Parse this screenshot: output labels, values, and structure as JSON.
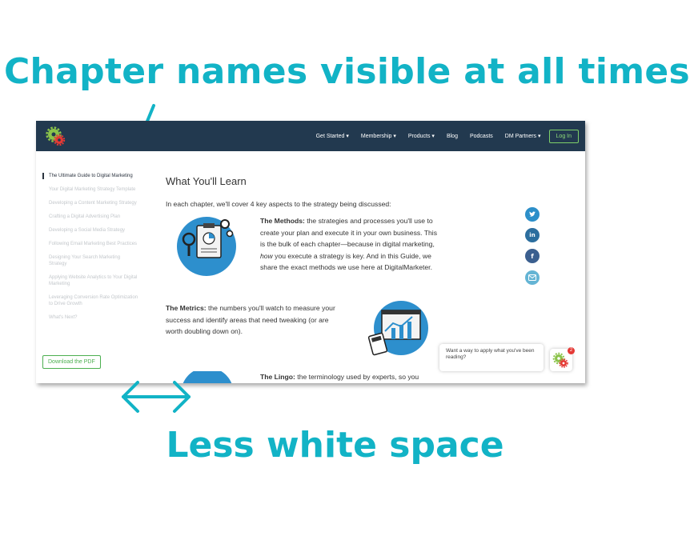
{
  "headline_top": "Chapter names visible at all times",
  "headline_bottom": "Less white space",
  "nav": {
    "items": [
      "Get Started",
      "Membership",
      "Products",
      "Blog",
      "Podcasts",
      "DM Partners"
    ],
    "login": "Log In"
  },
  "sidebar": {
    "items": [
      "The Ultimate Guide to Digital Marketing",
      "Your Digital Marketing Strategy Template",
      "Developing a Content Marketing Strategy",
      "Crafting a Digital Advertising Plan",
      "Developing a Social Media Strategy",
      "Following Email Marketing Best Practices",
      "Designing Your Search Marketing Strategy",
      "Applying Website Analytics to Your Digital Marketing",
      "Leveraging Conversion Rate Optimization to Drive Growth",
      "What's Next?"
    ],
    "pdf_button": "Download the PDF"
  },
  "main": {
    "title": "What You'll Learn",
    "intro": "In each chapter, we'll cover 4 key aspects to the strategy being discussed:",
    "methods_label": "The Methods:",
    "methods_text_1": " the strategies and processes you'll use to create your plan and execute it in your own business. This is the bulk of each chapter—because in digital marketing, ",
    "methods_em": "how",
    "methods_text_2": " you execute a strategy is key. And in this Guide, we share the exact methods we use here at DigitalMarketer.",
    "metrics_label": "The Metrics:",
    "metrics_text": " the numbers you'll watch to measure your success and identify areas that need tweaking (or are worth doubling down on).",
    "lingo_label": "The Lingo:",
    "lingo_text": " the terminology used by experts, so you"
  },
  "share": {
    "twitter_icon": "twitter-icon",
    "linkedin": "in",
    "facebook": "f",
    "email_icon": "email-icon"
  },
  "chat": {
    "prompt": "Want a way to apply what you've been reading?",
    "badge": "2"
  },
  "colors": {
    "accent": "#12b3c6",
    "nav_bg": "#22394f",
    "green": "#4caf50",
    "share_blue": "#2c8fc9"
  }
}
